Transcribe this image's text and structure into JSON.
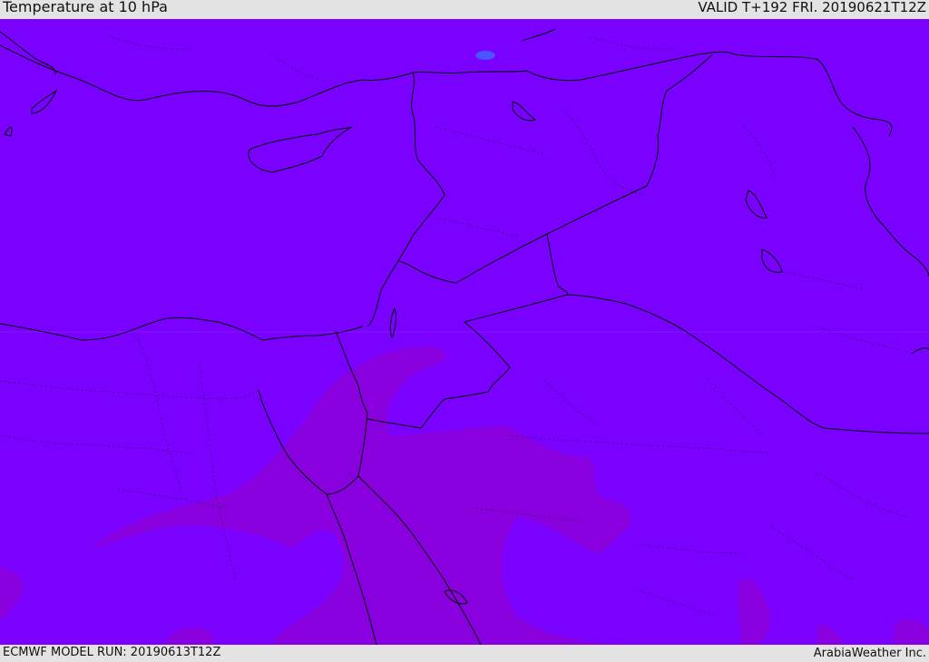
{
  "header": {
    "title": "Temperature at 10 hPa",
    "valid": "VALID T+192 FRI. 20190621T12Z"
  },
  "footer": {
    "model_run": "ECMWF MODEL RUN: 20190613T12Z",
    "credit": "ArabiaWeather Inc."
  },
  "colors": {
    "field_main": "#7a00ff",
    "field_warm": "#8700dd",
    "lake": "#4a55ff",
    "coast": "#000000"
  }
}
